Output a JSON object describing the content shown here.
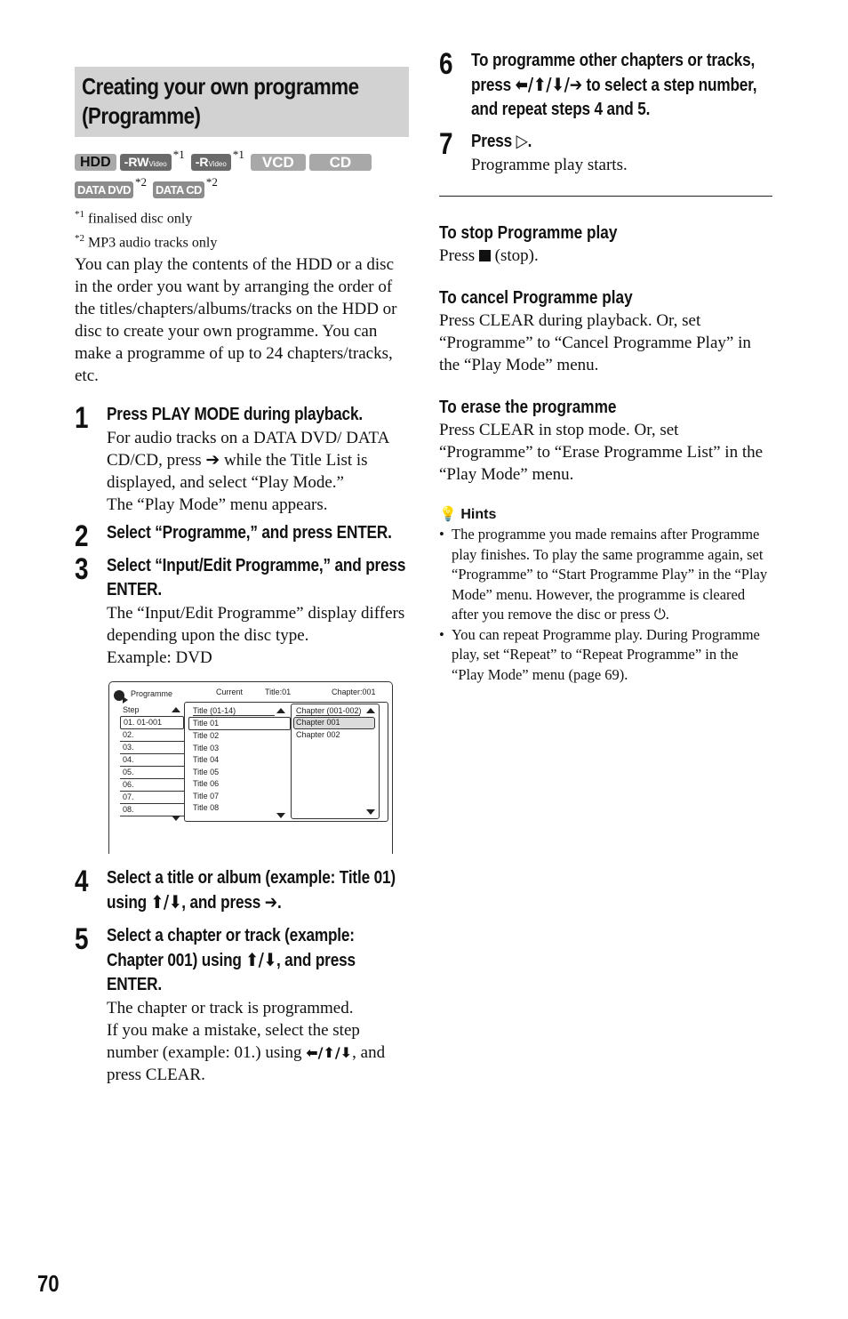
{
  "section_title": "Creating your own programme (Programme)",
  "badges": {
    "hdd": "HDD",
    "rw_main": "-RW",
    "rw_sub": "Video",
    "r_main": "-R",
    "r_sub": "Video",
    "vcd": "VCD",
    "cd": "CD",
    "data_dvd": "DATA DVD",
    "data_cd": "DATA CD",
    "note1_mark": "*1",
    "note2_mark": "*2"
  },
  "footnotes": [
    {
      "mark": "*1",
      "text": "finalised disc only"
    },
    {
      "mark": "*2",
      "text": "MP3 audio tracks only"
    }
  ],
  "intro": "You can play the contents of the HDD or a disc in the order you want by arranging the order of the titles/chapters/albums/tracks on the HDD or disc to create your own programme. You can make a programme of up to 24 chapters/tracks, etc.",
  "steps": [
    {
      "num": "1",
      "head": "Press PLAY MODE during playback.",
      "body_a": "For audio tracks on a DATA DVD/ DATA CD/CD, press",
      "body_b": "while the Title List is displayed, and select “Play Mode.”",
      "body_c": "The “Play Mode” menu appears."
    },
    {
      "num": "2",
      "head": "Select “Programme,” and press ENTER."
    },
    {
      "num": "3",
      "head": "Select “Input/Edit Programme,” and press ENTER.",
      "body": "The “Input/Edit Programme” display differs depending upon the disc type.",
      "body2": "Example: DVD"
    },
    {
      "num": "4",
      "head_a": "Select a title or album (example: Title 01) using",
      "head_b": ", and press"
    },
    {
      "num": "5",
      "head_a": "Select a chapter or track (example: Chapter 001) using",
      "head_b": ", and press ENTER.",
      "body": "The chapter or track is programmed.",
      "body2_a": "If you make a mistake, select the step number (example: 01.) using",
      "body2_b": ", and press CLEAR."
    },
    {
      "num": "6",
      "head_a": "To programme other chapters or tracks, press",
      "head_b": "to select a step number, and repeat steps 4 and 5."
    },
    {
      "num": "7",
      "head": "Press",
      "body": "Programme play starts."
    }
  ],
  "arrows": {
    "right": "➔",
    "up_down": "⬆/⬇",
    "left_up_down": "⬅/⬆/⬇",
    "all": "⬅/⬆/⬇/➔",
    "play": "▷"
  },
  "osd": {
    "title": "Programme",
    "current_label": "Current",
    "current_title": "Title:01",
    "current_chapter": "Chapter:001",
    "step_header": "Step",
    "steps": [
      "01. 01-001",
      "02.",
      "03.",
      "04.",
      "05.",
      "06.",
      "07.",
      "08."
    ],
    "title_header": "Title (01-14)",
    "titles": [
      "Title 01",
      "Title 02",
      "Title 03",
      "Title 04",
      "Title 05",
      "Title 06",
      "Title 07",
      "Title 08"
    ],
    "chapter_header": "Chapter (001-002)",
    "chapters": [
      "Chapter 001",
      "Chapter 002"
    ]
  },
  "stop": {
    "head": "To stop Programme play",
    "body_a": "Press",
    "body_b": "(stop)."
  },
  "cancel": {
    "head": "To cancel Programme play",
    "body": "Press CLEAR during playback. Or, set “Programme” to “Cancel Programme Play” in the “Play Mode” menu."
  },
  "erase": {
    "head": "To erase the programme",
    "body": "Press CLEAR in stop mode.  Or, set “Programme” to “Erase Programme List” in the “Play Mode” menu."
  },
  "hints": {
    "head": "Hints",
    "items": [
      "The programme you made remains after Programme play finishes. To play the same programme again, set “Programme” to “Start Programme Play” in the “Play Mode” menu. However, the programme is cleared after you remove the disc or press ⏻.",
      "You can repeat Programme play. During Programme play, set “Repeat” to “Repeat Programme” in the “Play Mode” menu (page 69)."
    ]
  },
  "page_number": "70"
}
